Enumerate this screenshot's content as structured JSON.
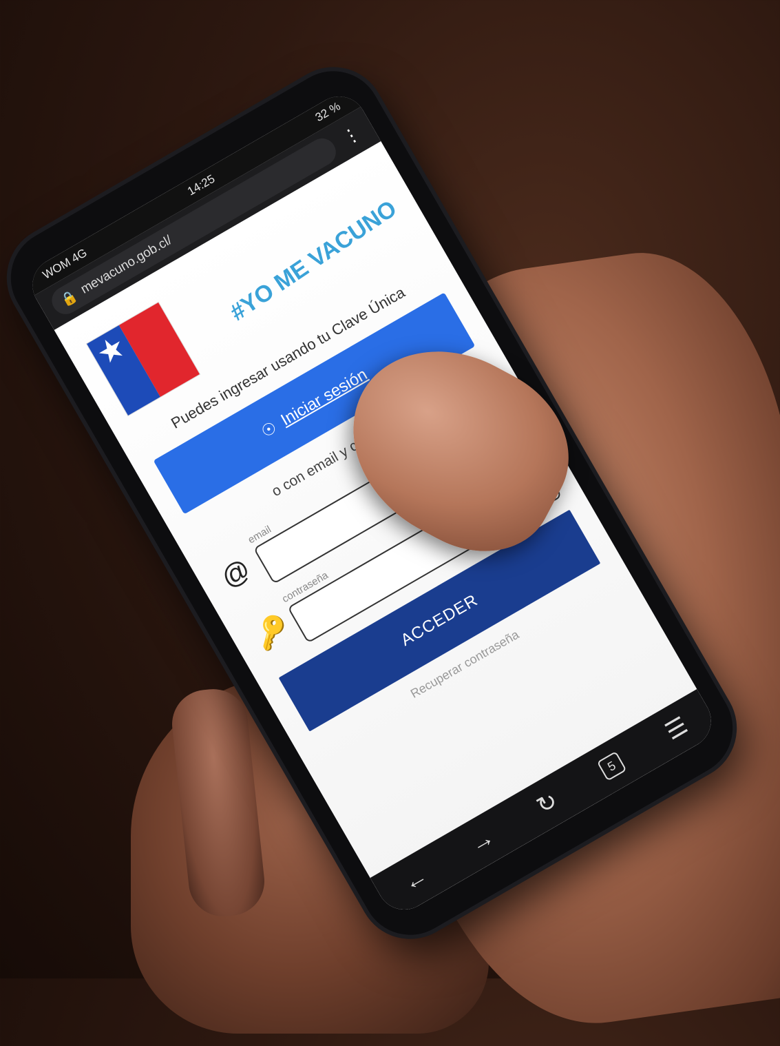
{
  "status_bar": {
    "network": "WOM 4G",
    "time": "14:25",
    "battery": "32 %"
  },
  "browser": {
    "url": "mevacuno.gob.cl/",
    "menu_icon": "more-dots-icon",
    "lock_icon": "lock-icon",
    "tab_count": "5"
  },
  "page": {
    "campaign_logo": "#YO ME VACUNO",
    "intro_text": "Puedes ingresar usando tu Clave Única",
    "login_button": "Iniciar sesión",
    "or_text": "o con email y contraseña",
    "email_label": "email",
    "password_label": "contraseña",
    "submit_button": "ACCEDER",
    "recover_link": "Recuperar contraseña"
  },
  "colors": {
    "login_blue": "#2a6ee6",
    "submit_navy": "#1a3d8f",
    "gov_blue": "#1d4bb8",
    "gov_red": "#e1262d"
  }
}
